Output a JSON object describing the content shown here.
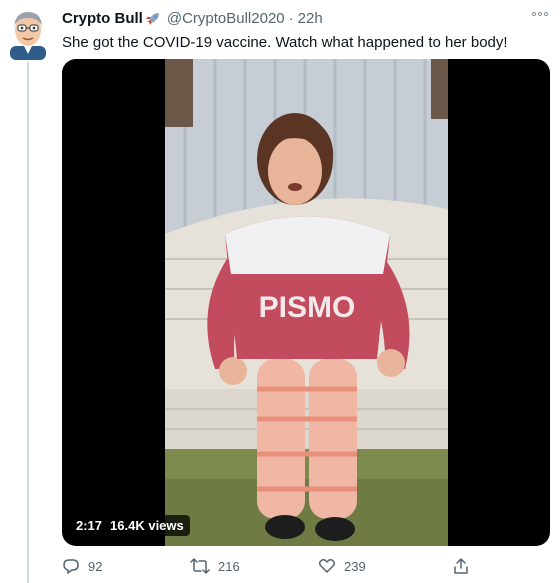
{
  "tweet": {
    "author_name": "Crypto Bull",
    "author_emoji_icon": "rocket-icon",
    "handle": "@CryptoBull2020",
    "separator": "·",
    "time": "22h",
    "text": "She got the COVID-19 vaccine. Watch what happened to her body!"
  },
  "video": {
    "duration": "2:17",
    "views": "16.4K views",
    "sweater_text": "PISMO"
  },
  "actions": {
    "replies": "92",
    "retweets": "216",
    "likes": "239"
  },
  "colors": {
    "text": "#0f1419",
    "secondary": "#536471",
    "thread_line": "#cfd9de"
  }
}
